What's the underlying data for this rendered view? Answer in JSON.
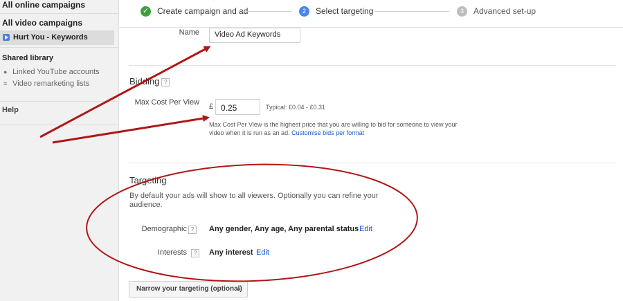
{
  "sidebar": {
    "all_online_campaigns": "All online campaigns",
    "all_video_campaigns": "All video campaigns",
    "selected_campaign": "Hurt You - Keywords",
    "shared_library": "Shared library",
    "linked_youtube": "Linked YouTube accounts",
    "video_remarketing": "Video remarketing lists",
    "help": "Help"
  },
  "wizard": {
    "steps": [
      {
        "label": "Create campaign and ad",
        "state": "done",
        "badge": "✓"
      },
      {
        "label": "Select targeting",
        "state": "current",
        "badge": "2"
      },
      {
        "label": "Advanced set-up",
        "state": "upcoming",
        "badge": "3"
      }
    ]
  },
  "name_field": {
    "label": "Name",
    "value": "Video Ad Keywords"
  },
  "bidding": {
    "title": "Bidding",
    "help": "?",
    "max_cpv_label": "Max Cost Per View",
    "currency": "£",
    "max_cpv_value": "0.25",
    "typical": "Typical: £0.04 - £0.31",
    "description": "Max Cost Per View is the highest price that you are willing to bid for someone to view your video when it is run as an ad.",
    "customise_link": "Customise bids per format"
  },
  "targeting": {
    "title": "Targeting",
    "description": "By default your ads will show to all viewers. Optionally you can refine your audience.",
    "demographic_label": "Demographic",
    "demographic_help": "?",
    "demographic_value": "Any gender, Any age, Any parental status",
    "demographic_edit": "Edit",
    "interests_label": "Interests",
    "interests_help": "?",
    "interests_value": "Any interest",
    "interests_edit": "Edit",
    "narrow_button": "Narrow your targeting (optional)"
  },
  "colors": {
    "annotation": "#b01616",
    "done_step": "#3e9e3e",
    "current_step": "#4a86e8",
    "upcoming_step": "#bdbdbd",
    "link": "#1155cc"
  }
}
